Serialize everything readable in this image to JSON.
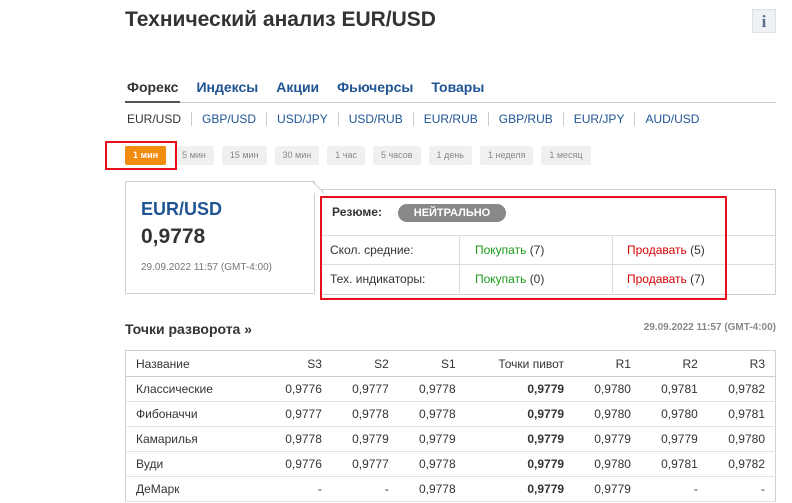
{
  "header": {
    "title": "Технический анализ EUR/USD",
    "info_label": "i"
  },
  "categories": [
    "Форекс",
    "Индексы",
    "Акции",
    "Фьючерсы",
    "Товары"
  ],
  "pairs": [
    "EUR/USD",
    "GBP/USD",
    "USD/JPY",
    "USD/RUB",
    "EUR/RUB",
    "GBP/RUB",
    "EUR/JPY",
    "AUD/USD"
  ],
  "timeframes": [
    "1 мин",
    "5 мин",
    "15 мин",
    "30 мин",
    "1 час",
    "5 часов",
    "1 день",
    "1 неделя",
    "1 месяц"
  ],
  "quote": {
    "pair": "EUR/USD",
    "price": "0,9778",
    "time": "29.09.2022 11:57 (GMT-4:00)"
  },
  "summary": {
    "label": "Резюме:",
    "badge": "НЕЙТРАЛЬНО",
    "rows": [
      {
        "label": "Скол. средние:",
        "buy": "Покупать",
        "buy_count": "(7)",
        "sell": "Продавать",
        "sell_count": "(5)"
      },
      {
        "label": "Тех. индикаторы:",
        "buy": "Покупать",
        "buy_count": "(0)",
        "sell": "Продавать",
        "sell_count": "(7)"
      }
    ]
  },
  "pivots": {
    "title": "Точки разворота »",
    "time": "29.09.2022 11:57 (GMT-4:00)",
    "columns": [
      "Название",
      "S3",
      "S2",
      "S1",
      "Точки пивот",
      "R1",
      "R2",
      "R3"
    ],
    "rows": [
      [
        "Классические",
        "0,9776",
        "0,9777",
        "0,9778",
        "0,9779",
        "0,9780",
        "0,9781",
        "0,9782"
      ],
      [
        "Фибоначчи",
        "0,9777",
        "0,9778",
        "0,9778",
        "0,9779",
        "0,9780",
        "0,9780",
        "0,9781"
      ],
      [
        "Камарилья",
        "0,9778",
        "0,9779",
        "0,9779",
        "0,9779",
        "0,9779",
        "0,9779",
        "0,9780"
      ],
      [
        "Вуди",
        "0,9776",
        "0,9777",
        "0,9778",
        "0,9779",
        "0,9780",
        "0,9781",
        "0,9782"
      ],
      [
        "ДеМарк",
        "-",
        "-",
        "0,9778",
        "0,9779",
        "0,9779",
        "-",
        "-"
      ]
    ]
  }
}
